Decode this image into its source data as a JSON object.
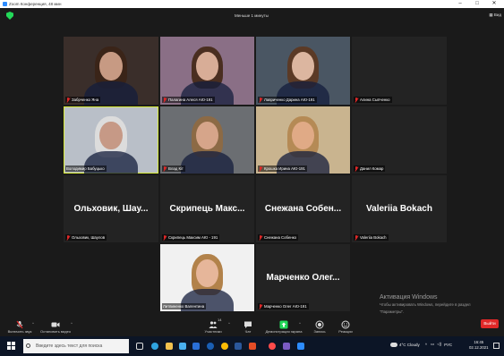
{
  "window": {
    "title": "Zoom Конференция, 48 мин",
    "minimize": "–",
    "maximize": "□",
    "close": "✕"
  },
  "topbar": {
    "duration": "Меньше 1 минуты",
    "view": "Вид"
  },
  "participants": [
    {
      "name": "Забрченко Яна",
      "muted": true,
      "video": true,
      "bg": "#3a2e2a",
      "face": "#c79a83",
      "hair": "#3a2418"
    },
    {
      "name": "Палагина Алеся АЮ-191",
      "muted": true,
      "video": true,
      "bg": "#8a6f86",
      "face": "#d8ad97",
      "hair": "#4a2e20"
    },
    {
      "name": "Лавриченко Дарина АЮ-191",
      "muted": true,
      "video": true,
      "bg": "#4a5663",
      "face": "#dcb6a0",
      "hair": "#5b3a26"
    },
    {
      "name": "Алина Сыпченко",
      "muted": true,
      "video": false,
      "bg": "#050505"
    },
    {
      "name": "Володимир Бабуцько",
      "muted": false,
      "video": true,
      "active": true,
      "bg": "#b9bfc8",
      "face": "#c69986",
      "hair": "#dcdcdc"
    },
    {
      "name": "Влад Кіт",
      "muted": true,
      "video": true,
      "bg": "#6b6e72",
      "face": "#d6a58a",
      "hair": "#8c6a45"
    },
    {
      "name": "Крошка Ирина АЮ-191",
      "muted": true,
      "video": true,
      "bg": "#c9b48f",
      "face": "#e0aa86",
      "hair": "#b58a55"
    },
    {
      "name": "Данил Комар",
      "muted": true,
      "video": false,
      "display": ""
    },
    {
      "name": "Ольховик, Шаулов",
      "muted": true,
      "video": false,
      "display": "Ольховик, Шау..."
    },
    {
      "name": "Скрипець Максим АЮ - 191",
      "muted": true,
      "video": false,
      "display": "Скрипець Макс..."
    },
    {
      "name": "Снежана Собенко",
      "muted": true,
      "video": false,
      "display": "Снежана Собен..."
    },
    {
      "name": "Valeriia Bokach",
      "muted": true,
      "video": false,
      "display": "Valeriia Bokach"
    },
    {
      "name": "Литвиненко Валентина",
      "muted": false,
      "video": true,
      "bg": "#f1f1f1",
      "face": "#e6b69a",
      "hair": "#b2824a"
    },
    {
      "name": "Марченко Олег АЮ-191",
      "muted": true,
      "video": false,
      "display": "Марченко Олег..."
    }
  ],
  "activation": {
    "title": "Активация Windows",
    "line1": "Чтобы активировать Windows, перейдите в раздел",
    "line2": "\"Параметры\"."
  },
  "controls": {
    "mute": "Включить звук",
    "video": "Остановить видео",
    "participants": "Участники",
    "participants_count": "14",
    "chat": "Чат",
    "share": "Демонстрация экрана",
    "record": "Запись",
    "reactions": "Реакции",
    "end": "Выйти"
  },
  "taskbar": {
    "search_placeholder": "Введите здесь текст для поиска",
    "weather": "4°C Cloudy",
    "lang": "РУС",
    "time": "16:45",
    "date": "02.12.2021"
  },
  "colors": {
    "accent_green": "#23d959",
    "active_speaker": "#d7ea3a",
    "danger": "#e02828",
    "bg": "#1a1a1a",
    "tile": "#232323"
  }
}
